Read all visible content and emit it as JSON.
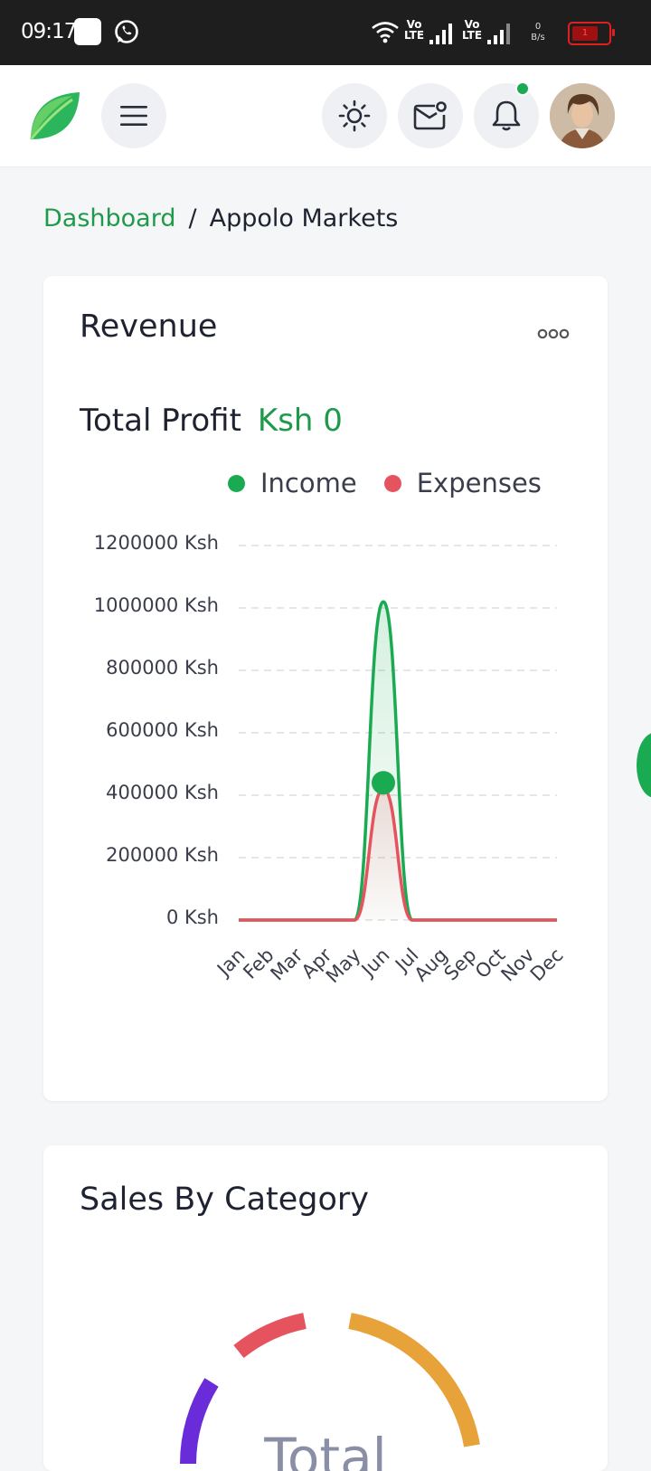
{
  "status_bar": {
    "time": "09:17",
    "lte1": "Vo LTE",
    "lte2": "Vo LTE",
    "net_speed_value": "0",
    "net_speed_unit": "B/s",
    "battery_level": "1"
  },
  "header": {
    "icons": [
      "leaf-logo-icon",
      "menu-icon",
      "sun-icon",
      "mail-icon",
      "bell-icon",
      "avatar"
    ],
    "accent": "#1aab52"
  },
  "breadcrumb": {
    "parent": "Dashboard",
    "separator": "/",
    "current": "Appolo Markets"
  },
  "revenue_card": {
    "title": "Revenue",
    "profit_label": "Total Profit",
    "profit_value": "Ksh 0",
    "legend": [
      {
        "label": "Income",
        "color": "#1aab52"
      },
      {
        "label": "Expenses",
        "color": "#e5535f"
      }
    ]
  },
  "chart_data": {
    "type": "area",
    "categories": [
      "Jan",
      "Feb",
      "Mar",
      "Apr",
      "May",
      "Jun",
      "Jul",
      "Aug",
      "Sep",
      "Oct",
      "Nov",
      "Dec"
    ],
    "series": [
      {
        "name": "Income",
        "color": "#1aab52",
        "values": [
          0,
          0,
          0,
          0,
          0,
          1020000,
          0,
          0,
          0,
          0,
          0,
          0
        ]
      },
      {
        "name": "Expenses",
        "color": "#e5535f",
        "values": [
          0,
          0,
          0,
          0,
          0,
          420000,
          0,
          0,
          0,
          0,
          0,
          0
        ]
      }
    ],
    "y_ticks": [
      "0 Ksh",
      "200000 Ksh",
      "400000 Ksh",
      "600000 Ksh",
      "800000 Ksh",
      "1000000 Ksh",
      "1200000 Ksh"
    ],
    "ylim": [
      0,
      1200000
    ],
    "grid": true,
    "legend_position": "top-right",
    "marker_category": "Jun",
    "marker_value": 440000
  },
  "sales_card": {
    "title": "Sales By Category",
    "donut_center_text": "Total",
    "segments": [
      {
        "color": "#6a2bd9"
      },
      {
        "color": "#e5535f"
      },
      {
        "color": "#e8a23a"
      }
    ]
  }
}
